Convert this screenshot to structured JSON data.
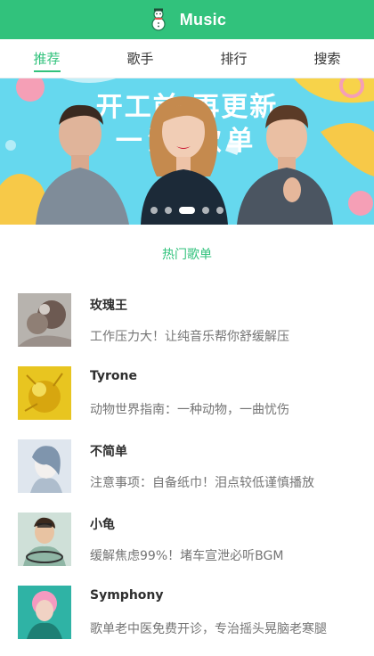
{
  "header": {
    "title": "Music",
    "logo_icon": "snowman-logo-icon",
    "color": "#31c27c"
  },
  "tabs": [
    {
      "label": "推荐",
      "active": true
    },
    {
      "label": "歌手",
      "active": false
    },
    {
      "label": "排行",
      "active": false
    },
    {
      "label": "搜索",
      "active": false
    }
  ],
  "banner": {
    "headline_line1": "开工前 再更新",
    "headline_line2": "一波 歌单",
    "slides": 5,
    "active_slide": 3
  },
  "section": {
    "title": "热门歌单"
  },
  "playlists": [
    {
      "name": "玫瑰王",
      "desc": "工作压力大！让纯音乐帮你舒缓解压"
    },
    {
      "name": "Tyrone",
      "desc": "动物世界指南：一种动物，一曲忧伤"
    },
    {
      "name": "不简单",
      "desc": "注意事项：自备纸巾！泪点较低谨慎播放"
    },
    {
      "name": "小龟",
      "desc": "缓解焦虑99%！堵车宣泄必听BGM"
    },
    {
      "name": "Symphony",
      "desc": "歌单老中医免费开诊，专治摇头晃脑老寒腿"
    }
  ]
}
